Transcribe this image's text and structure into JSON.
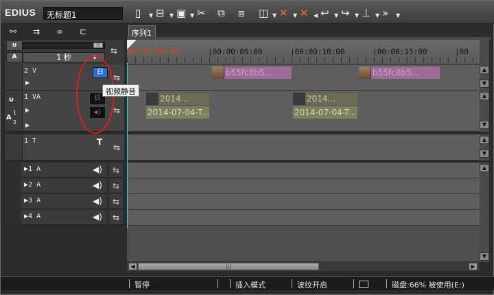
{
  "app": {
    "logo": "EDIUS",
    "project_name": "无标题1"
  },
  "toolbar": {
    "icons": [
      "new-sequence-icon",
      "open-project-icon",
      "save-icon",
      "cut-icon",
      "copy-icon",
      "paste-icon",
      "trim-icon",
      "delete-icon",
      "ripple-delete-icon",
      "undo-icon",
      "redo-icon",
      "marker-icon",
      "more-icon"
    ]
  },
  "sequence": {
    "tab": "序列1"
  },
  "timescale": {
    "value": "1 秒"
  },
  "ruler": {
    "current": "00:00:00:00",
    "marks": [
      "|00:00:05:00",
      "|00:00:10:00",
      "|00:00:15:00",
      "|00"
    ]
  },
  "tracks": {
    "v2": {
      "label": "2 V",
      "mute_glyph": "日"
    },
    "va1": {
      "label": "1 VA",
      "mute_glyph": "日"
    },
    "t1": {
      "label": "1 T",
      "title_glyph": "T"
    },
    "audio": [
      "1 A",
      "2 A",
      "3 A",
      "4 A"
    ]
  },
  "side_locks": {
    "top": "A",
    "va_letter": "A",
    "va_num_top": "1",
    "va_num_bottom": "2"
  },
  "clips": {
    "v2_clip1": "b55fc8b5...",
    "v2_clip2": "b55fc8b5...",
    "va_clip1_top": "2014...",
    "va_clip1_bottom": "2014-07-04-T...",
    "va_clip2_top": "2014...",
    "va_clip2_bottom": "2014-07-04-T..."
  },
  "tooltip": "视频静音",
  "status": {
    "playback": "暂停",
    "mode": "插入模式",
    "ripple": "波纹开启",
    "disk": "磁盘:66% 被使用(E:)"
  },
  "colors": {
    "accent_cursor": "#2fd8c0",
    "annotation": "#e51a1a",
    "v_mute_active": "#2a6fd6"
  }
}
